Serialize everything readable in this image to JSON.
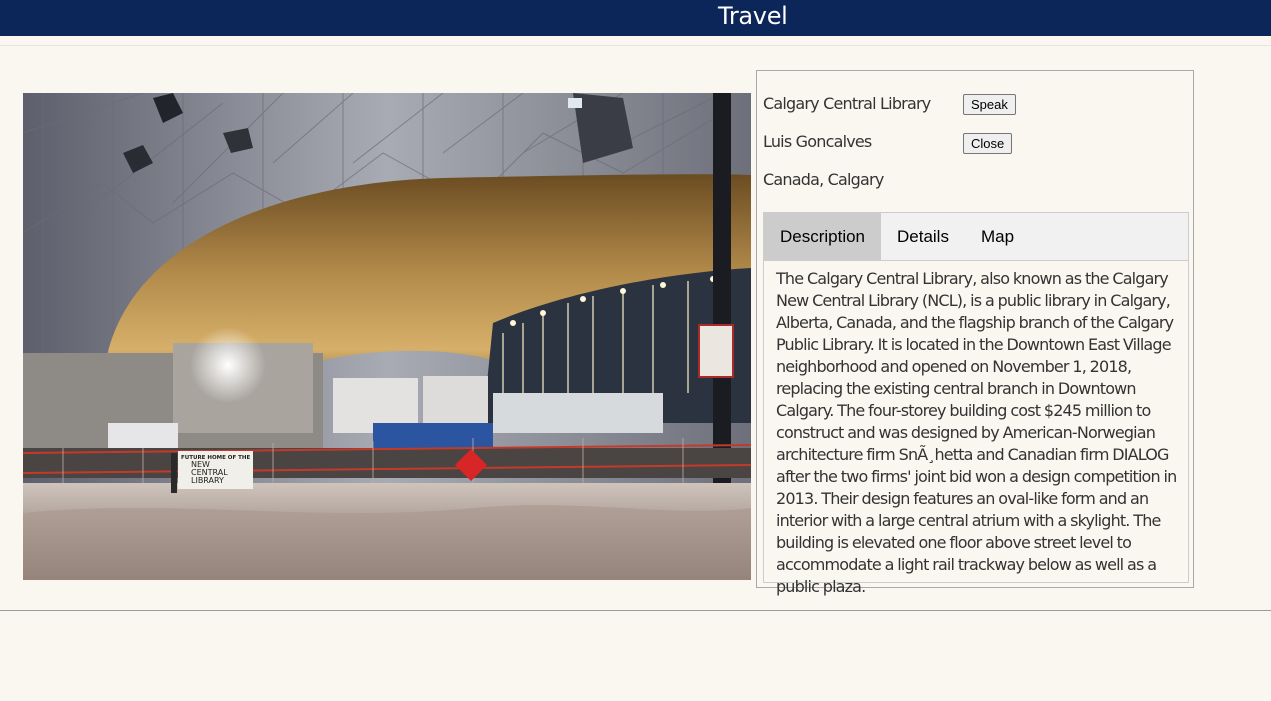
{
  "header": {
    "title": "Travel"
  },
  "photo": {
    "signage": [
      "FUTURE HOME OF THE",
      "NEW",
      "CENTRAL",
      "LIBRARY"
    ]
  },
  "info": {
    "place": "Calgary Central Library",
    "author": "Luis Goncalves",
    "location": "Canada, Calgary",
    "speak_label": "Speak",
    "close_label": "Close"
  },
  "tabs": {
    "items": [
      {
        "label": "Description",
        "active": true
      },
      {
        "label": "Details",
        "active": false
      },
      {
        "label": "Map",
        "active": false
      }
    ],
    "description": "The Calgary Central Library, also known as the Calgary New Central Library (NCL), is a public library in Calgary, Alberta, Canada, and the flagship branch of the Calgary Public Library. It is located in the Downtown East Village neighborhood and opened on November 1, 2018, replacing the existing central branch in Downtown Calgary. The four-storey building cost $245 million to construct and was designed by American-Norwegian architecture firm SnÃ¸hetta and Canadian firm DIALOG after the two firms' joint bid won a design competition in 2013. Their design features an oval-like form and an interior with a large central atrium with a skylight. The building is elevated one floor above street level to accommodate a light rail trackway below as well as a public plaza."
  },
  "colors": {
    "header_bg": "#0c2659",
    "page_bg": "#f9f7ef",
    "tab_active": "#cccccc"
  }
}
